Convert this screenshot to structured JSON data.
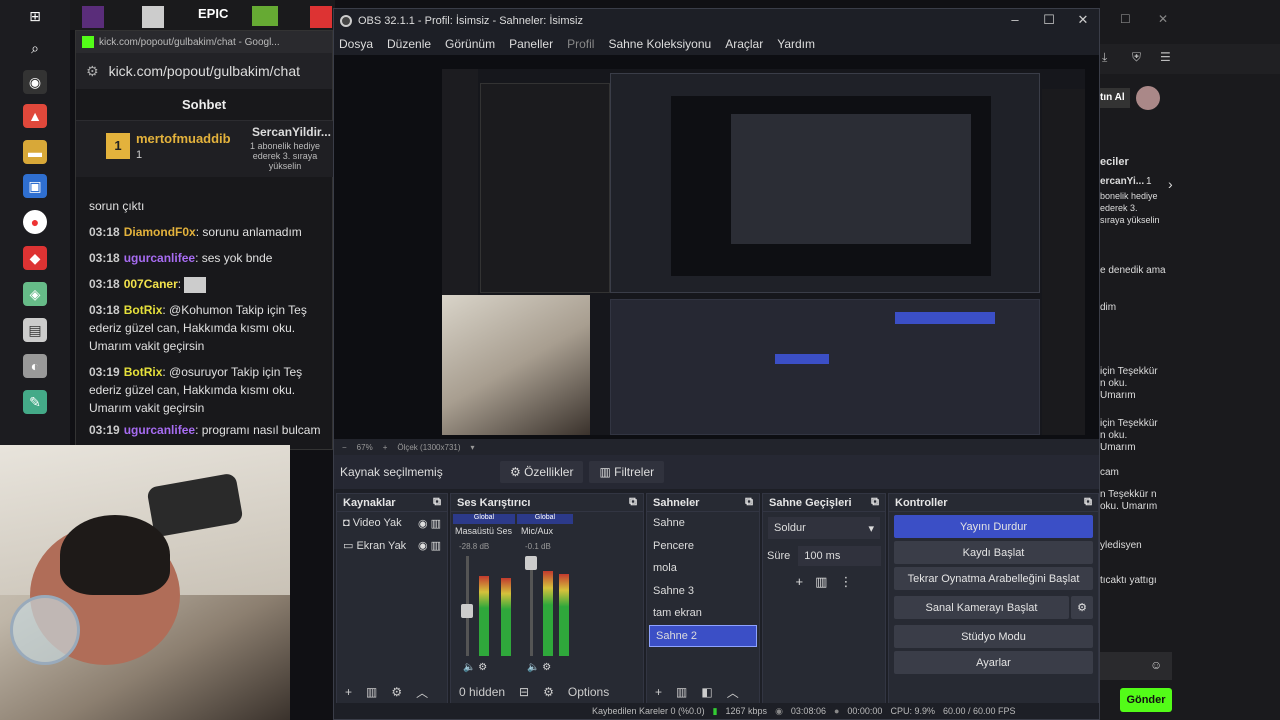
{
  "chrome_popup": {
    "title": "kick.com/popout/gulbakim/chat - Googl...",
    "url": "kick.com/popout/gulbakim/chat",
    "chat_title": "Sohbet",
    "pinned": {
      "rank": "1",
      "user1": "mertofmuaddib",
      "count1": "1",
      "user2": "SercanYildir...",
      "desc": "1 abonelik hediye ederek 3. sıraya yükselin"
    },
    "messages": [
      {
        "time": "",
        "user": "",
        "text": "sorun çıktı"
      },
      {
        "time": "03:18",
        "user": "DiamondF0x",
        "text": "sorunu anlamadım"
      },
      {
        "time": "03:18",
        "user": "ugurcanlifee",
        "text": "ses yok bnde"
      },
      {
        "time": "03:18",
        "user": "007Caner",
        "text": ""
      },
      {
        "time": "03:18",
        "user": "BotRix",
        "text": "@Kohumon Takip için Teş ederiz güzel can, Hakkımda kısmı oku. Umarım vakit geçirsin"
      },
      {
        "time": "03:19",
        "user": "BotRix",
        "text": "@osuruyor Takip için Teş ederiz güzel can, Hakkımda kısmı oku. Umarım vakit geçirsin"
      },
      {
        "time": "03:19",
        "user": "ugurcanlifee",
        "text": "programı nasıl bulcam"
      }
    ]
  },
  "obs": {
    "title": "OBS 32.1.1 - Profil: İsimsiz - Sahneler: İsimsiz",
    "menu": [
      "Dosya",
      "Düzenle",
      "Görünüm",
      "Paneller",
      "Profil",
      "Sahne Koleksiyonu",
      "Araçlar",
      "Yardım"
    ],
    "preview_bar": {
      "zoom": "67%",
      "canvas": "Ölçek (1300x731)"
    },
    "source_bar": {
      "none": "Kaynak seçilmemiş",
      "props": "Özellikler",
      "filters": "Filtreler"
    },
    "sources": {
      "title": "Kaynaklar",
      "items": [
        "Video Yak",
        "Ekran Yak"
      ]
    },
    "mixer": {
      "title": "Ses Karıştırıcı",
      "ch1": {
        "tag": "Global",
        "name": "Masaüstü Ses",
        "db": "-28.8 dB"
      },
      "ch2": {
        "tag": "Global",
        "name": "Mic/Aux",
        "db": "-0.1 dB"
      },
      "scale": [
        "0",
        "-6",
        "-12",
        "-18",
        "-24",
        "-30",
        "-36",
        "-42",
        "-48",
        "-54",
        "-60"
      ],
      "hidden": "0 hidden",
      "options": "Options"
    },
    "scenes": {
      "title": "Sahneler",
      "items": [
        "Sahne",
        "Pencere",
        "mola",
        "Sahne 3",
        "tam ekran",
        "Sahne 2"
      ],
      "selected": "Sahne 2"
    },
    "transitions": {
      "title": "Sahne Geçişleri",
      "type": "Soldur",
      "duration_label": "Süre",
      "duration": "100 ms"
    },
    "controls": {
      "title": "Kontroller",
      "buttons": [
        "Yayını Durdur",
        "Kaydı Başlat",
        "Tekrar Oynatma Arabelleğini Başlat",
        "Sanal Kamerayı Başlat",
        "Stüdyo Modu",
        "Ayarlar"
      ]
    },
    "status": {
      "dropped": "Kaybedilen Kareler 0 (%0.0)",
      "bitrate": "1267 kbps",
      "live": "03:08:06",
      "rec": "00:00:00",
      "cpu": "CPU: 9.9%",
      "fps": "60.00 / 60.00 FPS"
    }
  },
  "right_panel": {
    "user": "tın Al",
    "supporters": "eciler",
    "sup_user": "ercanYi...",
    "sup_count": "1",
    "sup_desc": "bonelik hediye ederek 3. sıraya yükselin",
    "lines": [
      "e denedik ama",
      "dim",
      "için Teşekkür n oku. Umarım",
      "için Teşekkür n oku. Umarım",
      "cam",
      "n Teşekkür n oku. Umarım",
      "yledisyen",
      "tıcaktı yattıgı"
    ],
    "send": "Gönder"
  },
  "colors": {
    "accent": "#3b4fc6",
    "kick_green": "#53fc18"
  }
}
